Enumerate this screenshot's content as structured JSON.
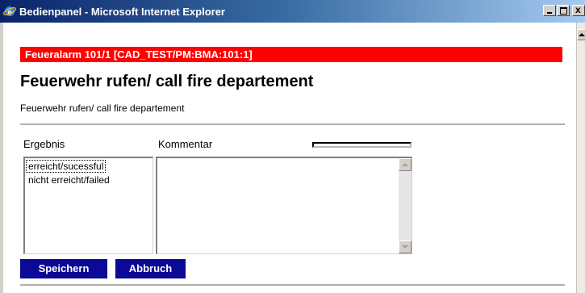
{
  "window": {
    "title": "Bedienpanel - Microsoft Internet Explorer",
    "icon": "ie-icon",
    "controls": [
      "minimize-icon",
      "maximize-icon",
      "close-icon"
    ],
    "close_glyph": "x"
  },
  "alarm": {
    "text": "Feueralarm 101/1 [CAD_TEST/PM:BMA:101:1]",
    "color": "#ff0000"
  },
  "page": {
    "heading": "Feuerwehr rufen/ call fire departement",
    "subtext": "Feuerwehr rufen/ call fire departement"
  },
  "form": {
    "result_label": "Ergebnis",
    "comment_label": "Kommentar",
    "result_options": [
      "erreicht/sucessful",
      "nicht erreicht/failed"
    ],
    "comment_value": ""
  },
  "buttons": {
    "save_label": "Speichern",
    "cancel_label": "Abbruch",
    "color": "#0a0a96"
  }
}
